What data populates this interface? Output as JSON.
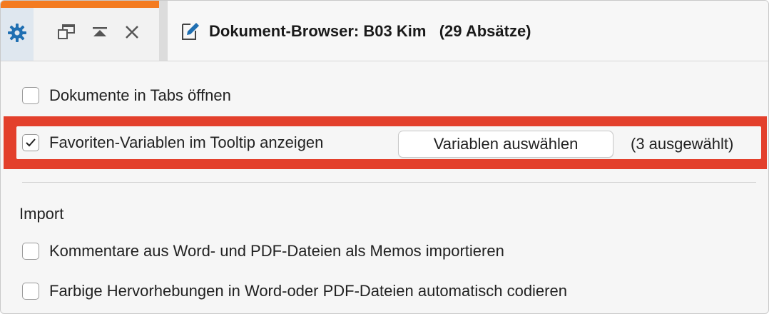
{
  "header": {
    "title": "Dokument-Browser: B03 Kim   (29 Absätze)",
    "icons": [
      "gear-icon",
      "float-window-icon",
      "collapse-up-icon",
      "close-icon",
      "edit-document-icon"
    ],
    "accent_color": "#f47b20"
  },
  "options": {
    "tabs_label": "Dokumente in Tabs öffnen",
    "tabs_checked": false,
    "favorites_label": "Favoriten-Variablen im Tooltip anzeigen",
    "favorites_checked": true,
    "select_button": "Variablen auswählen",
    "selected_count": "(3 ausgewählt)",
    "highlight_color": "#e3402c"
  },
  "import": {
    "heading": "Import",
    "comments_label": "Kommentare aus Word- und PDF-Dateien als Memos importieren",
    "comments_checked": false,
    "highlights_label": "Farbige Hervorhebungen in Word-oder PDF-Dateien automatisch codieren",
    "highlights_checked": false
  }
}
